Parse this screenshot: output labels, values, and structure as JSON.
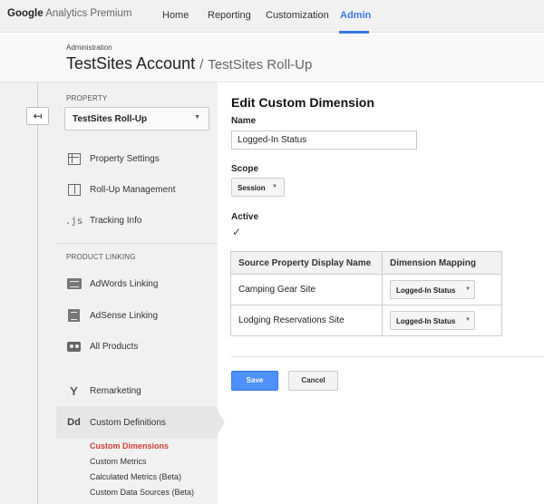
{
  "topbar": {
    "logo_google": "Google",
    "logo_rest": "Analytics Premium",
    "nav": [
      "Home",
      "Reporting",
      "Customization",
      "Admin"
    ],
    "active_nav": "Admin"
  },
  "header": {
    "admin_label": "Administration",
    "account": "TestSites Account",
    "separator": "/",
    "property": "TestSites Roll-Up"
  },
  "sidebar": {
    "property_label": "PROPERTY",
    "property_select": "TestSites Roll-Up",
    "items": [
      {
        "label": "Property Settings",
        "icon": "property-settings-icon"
      },
      {
        "label": "Roll-Up Management",
        "icon": "rollup-management-icon"
      },
      {
        "label": "Tracking Info",
        "icon": "js-icon"
      }
    ],
    "js_glyph": ".js",
    "product_linking_label": "PRODUCT LINKING",
    "linking_items": [
      {
        "label": "AdWords Linking",
        "icon": "adwords-icon"
      },
      {
        "label": "AdSense Linking",
        "icon": "adsense-icon"
      },
      {
        "label": "All Products",
        "icon": "all-products-icon"
      }
    ],
    "remarketing": "Remarketing",
    "custom_definitions": "Custom Definitions",
    "dd_glyph": "Dd",
    "submenu": [
      "Custom Dimensions",
      "Custom Metrics",
      "Calculated Metrics (Beta)",
      "Custom Data Sources (Beta)"
    ]
  },
  "main": {
    "title": "Edit Custom Dimension",
    "name_label": "Name",
    "name_value": "Logged-In Status",
    "scope_label": "Scope",
    "scope_value": "Session",
    "active_label": "Active",
    "active_checked": "✓",
    "table": {
      "headers": [
        "Source Property Display Name",
        "Dimension Mapping"
      ],
      "rows": [
        {
          "source": "Camping Gear Site",
          "mapping": "Logged-In Status"
        },
        {
          "source": "Lodging Reservations Site",
          "mapping": "Logged-In Status"
        }
      ]
    },
    "save_label": "Save",
    "cancel_label": "Cancel"
  },
  "colors": {
    "accent": "#3a78e6",
    "primary_button": "#4d90fe",
    "active_submenu": "#d23c30"
  }
}
